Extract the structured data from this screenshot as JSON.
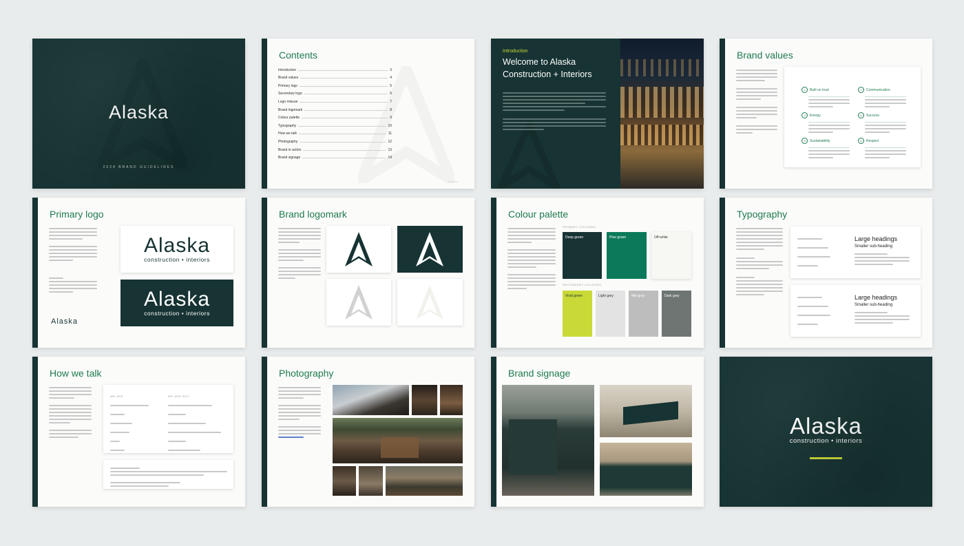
{
  "brand": {
    "name": "Alaska",
    "tagline": "construction • interiors",
    "guidelines": "2024 BRAND GUIDELINES"
  },
  "colors": {
    "deep_green": "#173333",
    "pine_green": "#0c7a5a",
    "off_white": "#f7f7f3",
    "vivid_green": "#c9d937",
    "light_grey": "#d9d9d9",
    "mid_grey": "#b3b3b3",
    "dark_grey": "#6f7573",
    "heading_green": "#1e7a4f"
  },
  "contents": {
    "title": "Contents",
    "items": [
      {
        "label": "Introduction",
        "page": "3"
      },
      {
        "label": "Brand values",
        "page": "4"
      },
      {
        "label": "Primary logo",
        "page": "5"
      },
      {
        "label": "Secondary logo",
        "page": "6"
      },
      {
        "label": "Logo misuse",
        "page": "7"
      },
      {
        "label": "Brand logomark",
        "page": "8"
      },
      {
        "label": "Colour palette",
        "page": "9"
      },
      {
        "label": "Typography",
        "page": "10"
      },
      {
        "label": "How we talk",
        "page": "11"
      },
      {
        "label": "Photography",
        "page": "12"
      },
      {
        "label": "Brand in action",
        "page": "13"
      },
      {
        "label": "Brand signage",
        "page": "14"
      }
    ]
  },
  "intro": {
    "kicker": "Introduction",
    "title_line1": "Welcome to Alaska",
    "title_line2": "Construction + Interiors"
  },
  "values": {
    "title": "Brand values",
    "items": [
      {
        "num": "1",
        "name": "Built on trust"
      },
      {
        "num": "2",
        "name": "Communication"
      },
      {
        "num": "3",
        "name": "Energy"
      },
      {
        "num": "4",
        "name": "Success"
      },
      {
        "num": "5",
        "name": "Sustainability"
      },
      {
        "num": "6",
        "name": "Respect"
      }
    ]
  },
  "primary_logo": {
    "title": "Primary logo"
  },
  "logomark": {
    "title": "Brand logomark"
  },
  "palette": {
    "title": "Colour palette",
    "primary_label": "PRIMARY COLOURS",
    "secondary_label": "SECONDARY COLOURS",
    "primary": [
      "Deep green",
      "Pine green",
      "Off-white"
    ],
    "secondary": [
      "Vivid green",
      "Light grey",
      "Mid grey",
      "Dark grey"
    ]
  },
  "typography": {
    "title": "Typography",
    "large": "Large headings",
    "small": "Smaller sub-heading"
  },
  "talk": {
    "title": "How we talk",
    "col1_head": "WE ARE",
    "col2_head": "WE ARE NOT"
  },
  "photography": {
    "title": "Photography"
  },
  "signage": {
    "title": "Brand signage"
  }
}
